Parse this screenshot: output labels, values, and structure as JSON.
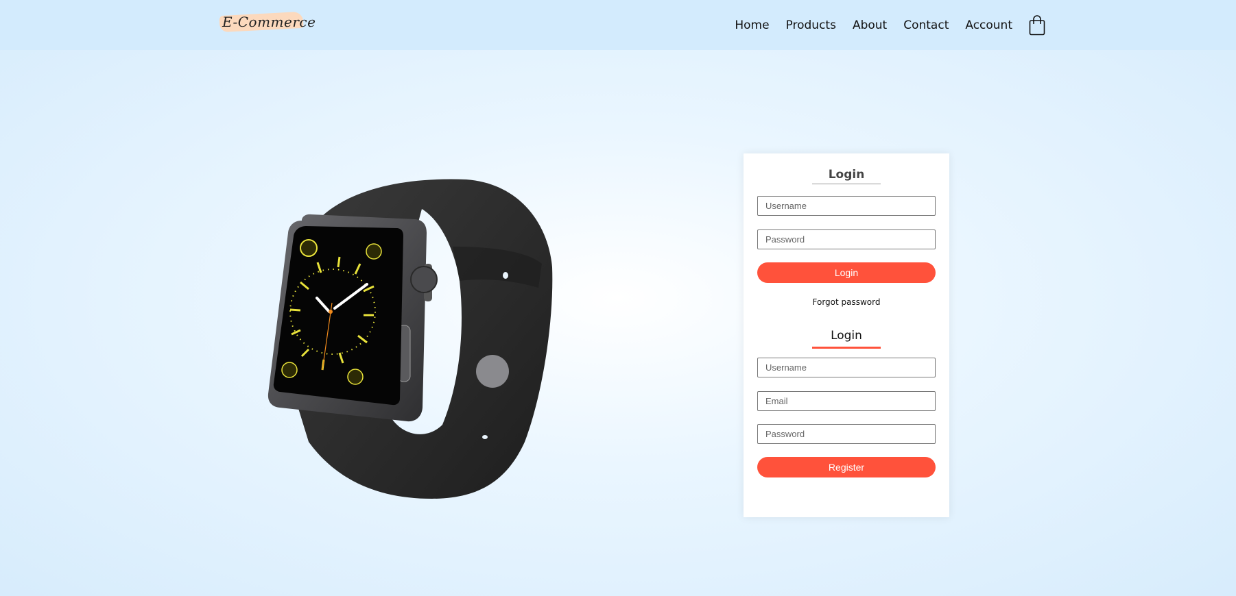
{
  "header": {
    "logo": "E-Commerce",
    "nav": [
      "Home",
      "Products",
      "About",
      "Contact",
      "Account"
    ]
  },
  "hero": {
    "image": "smartwatch-image"
  },
  "login_form": {
    "title": "Login",
    "username_placeholder": "Username",
    "password_placeholder": "Password",
    "submit_label": "Login",
    "forgot_label": "Forgot password"
  },
  "register_form": {
    "title": "Login",
    "username_placeholder": "Username",
    "email_placeholder": "Email",
    "password_placeholder": "Password",
    "submit_label": "Register"
  },
  "colors": {
    "accent": "#ff523b",
    "header_bg": "#d3ebfd"
  }
}
